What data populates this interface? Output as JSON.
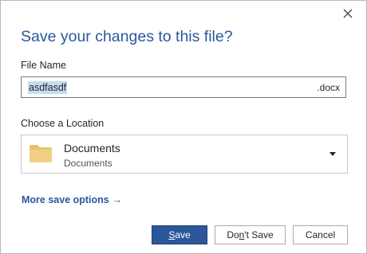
{
  "dialog": {
    "title": "Save your changes to this file?",
    "close_icon": "close-icon"
  },
  "file_name": {
    "label": "File Name",
    "value": "asdfasdf",
    "extension": ".docx"
  },
  "location": {
    "label": "Choose a Location",
    "name": "Documents",
    "path": "Documents",
    "icon": "folder-icon",
    "folder_color": "#e8c16f"
  },
  "more_options": {
    "label": "More save options",
    "arrow": "→"
  },
  "buttons": {
    "save": {
      "pre": "",
      "accel": "S",
      "post": "ave"
    },
    "dont_save": {
      "pre": "Do",
      "accel": "n",
      "post": "'t Save"
    },
    "cancel": {
      "label": "Cancel"
    }
  },
  "colors": {
    "accent": "#2b579a",
    "selection": "#c7dcf3"
  }
}
